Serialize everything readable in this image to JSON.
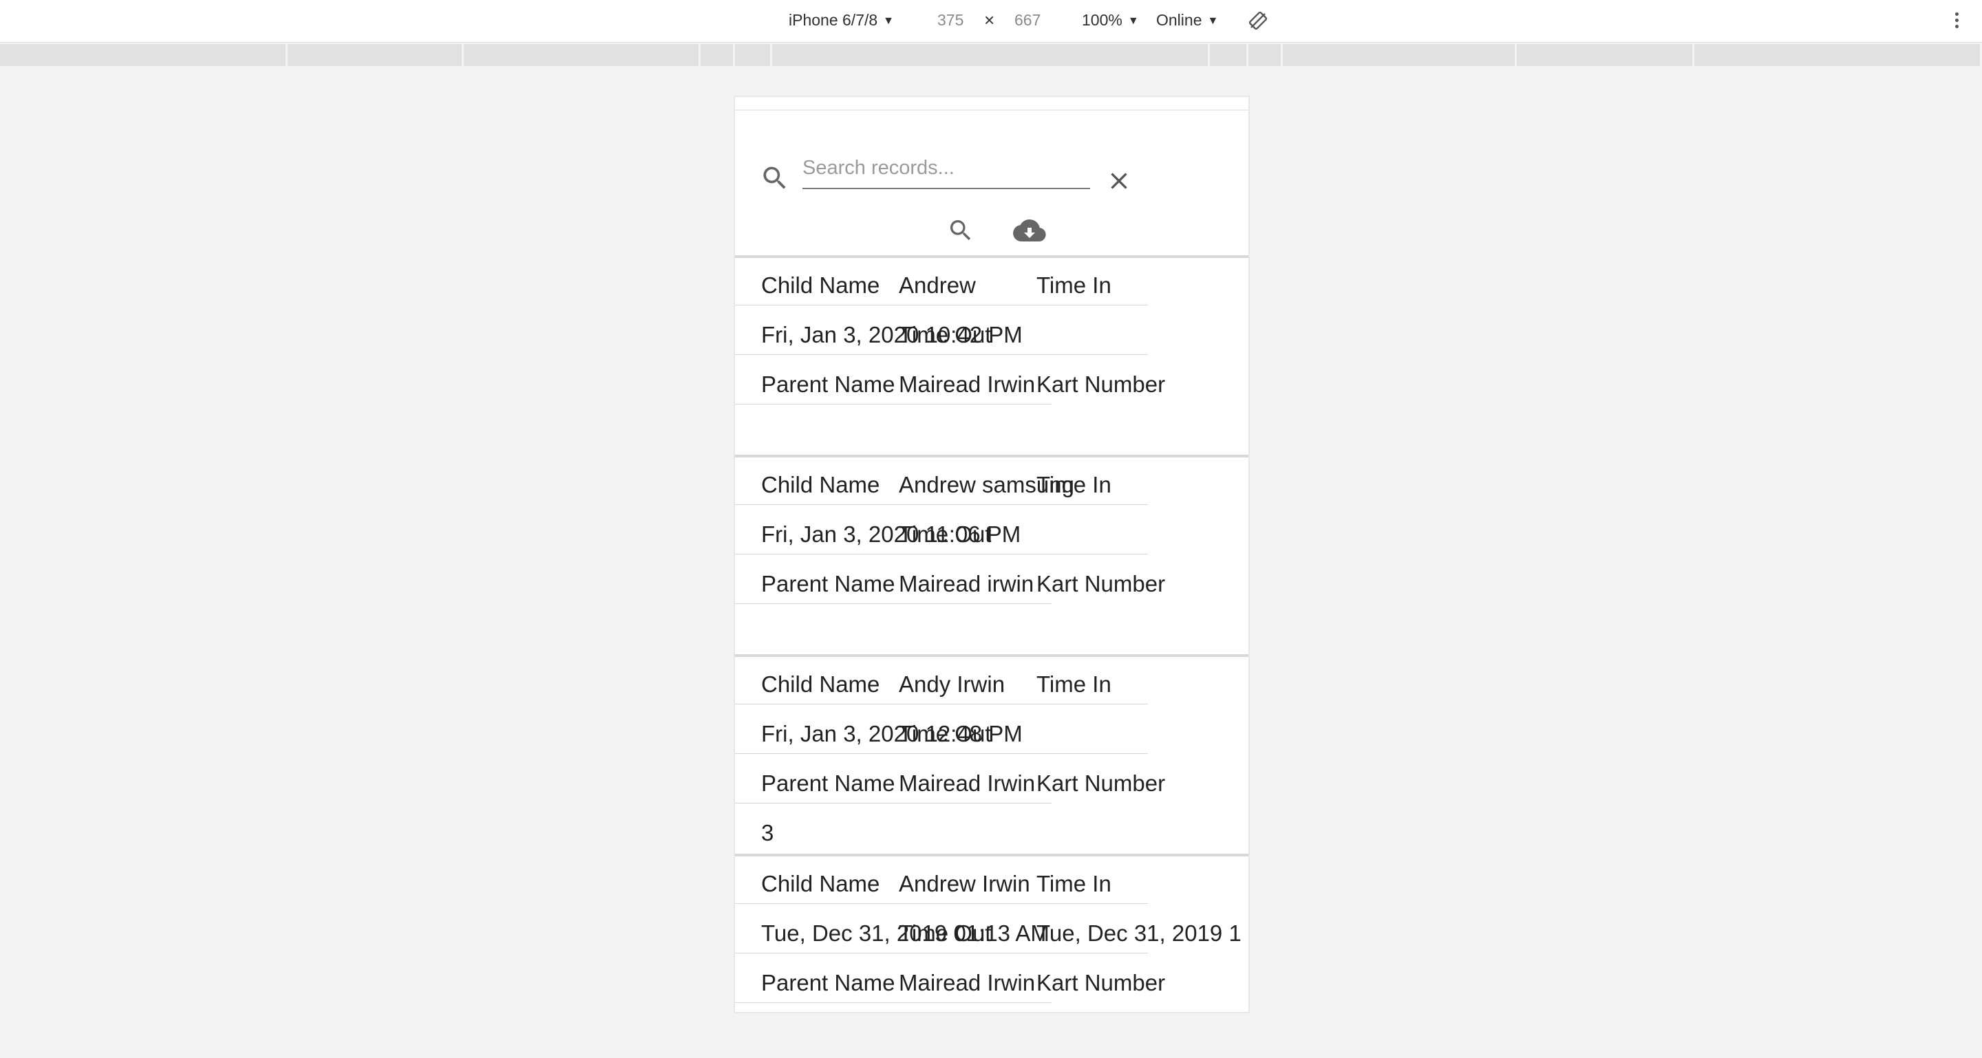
{
  "devtools": {
    "device": "iPhone 6/7/8",
    "width": "375",
    "times": "×",
    "height": "667",
    "zoom": "100%",
    "network": "Online"
  },
  "search": {
    "placeholder": "Search records..."
  },
  "records": [
    {
      "child_label": "Child Name",
      "child_value": "Andrew",
      "time_in_label": "Time In",
      "time_in_value": "Fri, Jan 3, 2020 10:42 PM",
      "time_out_label": "Time Out",
      "parent_label": "Parent Name",
      "parent_value": "Mairead Irwin",
      "kart_label": "Kart Number",
      "kart_value": ""
    },
    {
      "child_label": "Child Name",
      "child_value": "Andrew samsung",
      "time_in_label": "Time In",
      "time_in_value": "Fri, Jan 3, 2020 11:06 PM",
      "time_out_label": "Time Out",
      "parent_label": "Parent Name",
      "parent_value": "Mairead irwin",
      "kart_label": "Kart Number",
      "kart_value": ""
    },
    {
      "child_label": "Child Name",
      "child_value": "Andy Irwin",
      "time_in_label": "Time In",
      "time_in_value": "Fri, Jan 3, 2020 12:48 PM",
      "time_out_label": "Time Out",
      "parent_label": "Parent Name",
      "parent_value": "Mairead Irwin",
      "kart_label": "Kart Number",
      "kart_value": "3"
    },
    {
      "child_label": "Child Name",
      "child_value": "Andrew Irwin",
      "time_in_label": "Time In",
      "time_in_value": "Tue, Dec 31, 2019 01:13 AM",
      "time_out_label": "Time Out",
      "time_out_value": "Tue, Dec 31, 2019 1",
      "parent_label": "Parent Name",
      "parent_value": "Mairead Irwin",
      "kart_label": "Kart Number",
      "kart_value": ""
    }
  ]
}
